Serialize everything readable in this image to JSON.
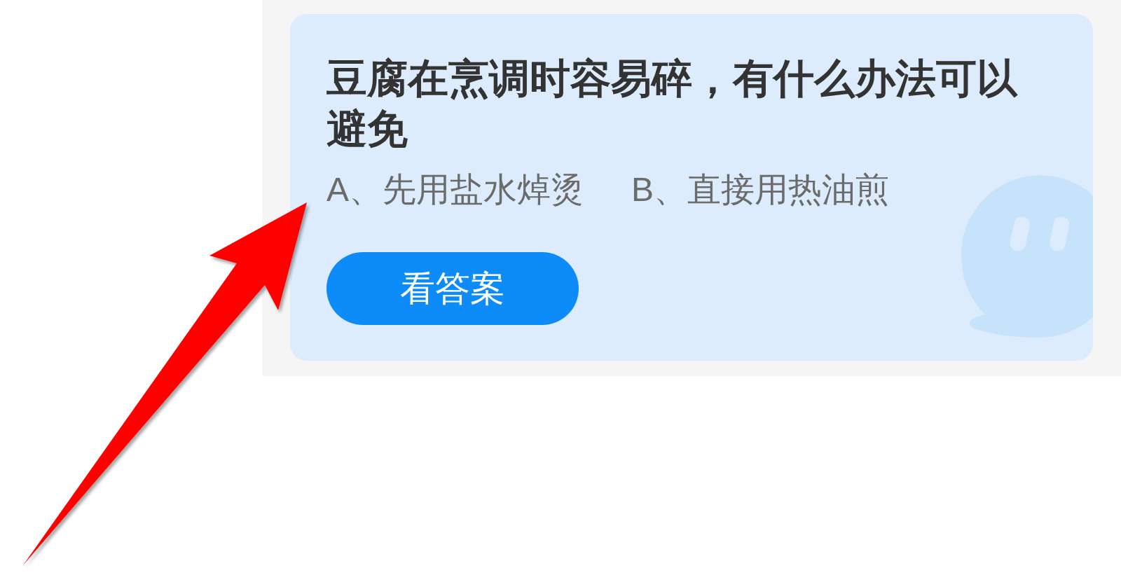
{
  "question": {
    "title": "豆腐在烹调时容易碎，有什么办法可以避免",
    "options": [
      {
        "text": "A、先用盐水焯烫"
      },
      {
        "text": "B、直接用热油煎"
      }
    ],
    "button": {
      "label": "看答案"
    }
  }
}
